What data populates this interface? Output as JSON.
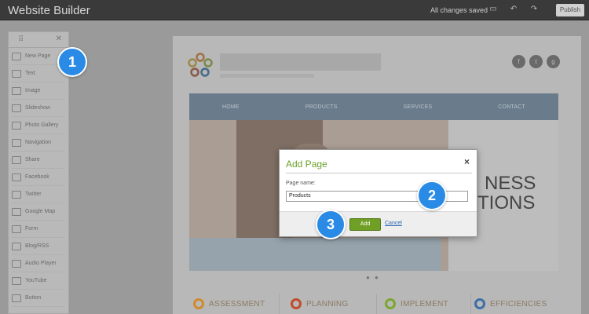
{
  "app": {
    "title": "Website Builder",
    "status": "All changes saved",
    "publish_label": "Publish"
  },
  "sidebar": {
    "items": [
      {
        "label": "New Page",
        "icon": "page-icon"
      },
      {
        "label": "Text",
        "icon": "text-icon"
      },
      {
        "label": "Image",
        "icon": "image-icon"
      },
      {
        "label": "Slideshow",
        "icon": "slideshow-icon"
      },
      {
        "label": "Photo Gallery",
        "icon": "gallery-icon"
      },
      {
        "label": "Navigation",
        "icon": "navigation-icon"
      },
      {
        "label": "Share",
        "icon": "share-icon"
      },
      {
        "label": "Facebook",
        "icon": "facebook-icon"
      },
      {
        "label": "Twitter",
        "icon": "twitter-icon"
      },
      {
        "label": "Google Map",
        "icon": "map-icon"
      },
      {
        "label": "Form",
        "icon": "form-icon"
      },
      {
        "label": "Blog/RSS",
        "icon": "rss-icon"
      },
      {
        "label": "Audio Player",
        "icon": "audio-icon"
      },
      {
        "label": "YouTube",
        "icon": "youtube-icon"
      },
      {
        "label": "Button",
        "icon": "button-icon"
      }
    ]
  },
  "site": {
    "nav": [
      "HOME",
      "PRODUCTS",
      "SERVICES",
      "CONTACT"
    ],
    "hero_line1": "NESS",
    "hero_line2": "TIONS",
    "features": [
      "ASSESSMENT",
      "PLANNING",
      "IMPLEMENT",
      "EFFICIENCIES"
    ],
    "feature_colors": [
      "#d08a2a",
      "#c24b2b",
      "#7aa82e",
      "#3d6ea8"
    ]
  },
  "dialog": {
    "title": "Add Page",
    "close_glyph": "×",
    "field_label": "Page name:",
    "field_value": "Products",
    "add_label": "Add",
    "cancel_label": "Cancel"
  },
  "callouts": [
    "1",
    "2",
    "3"
  ],
  "colors": {
    "accent_green": "#6f9f25",
    "callout_blue": "#2a8be6",
    "nav_bar": "#6a7b8b"
  }
}
